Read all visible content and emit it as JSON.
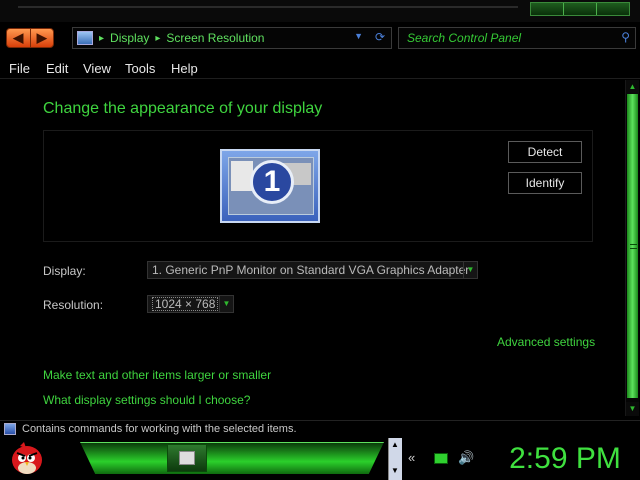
{
  "address_bar": {
    "crumbs": [
      "Display",
      "Screen Resolution"
    ],
    "separator": "▸"
  },
  "search": {
    "placeholder": "Search Control Panel"
  },
  "menu": {
    "items": [
      "File",
      "Edit",
      "View",
      "Tools",
      "Help"
    ]
  },
  "main": {
    "heading": "Change the appearance of your display",
    "monitor_number": "1",
    "detect_label": "Detect",
    "identify_label": "Identify",
    "display_label": "Display:",
    "display_value": "1. Generic PnP Monitor on Standard VGA Graphics Adapter",
    "resolution_label": "Resolution:",
    "resolution_value": "1024 × 768",
    "advanced_link": "Advanced settings",
    "text_size_link": "Make text and other items larger or smaller",
    "help_link": "What display settings should I choose?"
  },
  "status_bar": {
    "text": "Contains commands for working with the selected items."
  },
  "taskbar": {
    "clock": "2:59 PM"
  },
  "colors": {
    "accent_green": "#3fd43f",
    "nav_orange": "#e8621e",
    "link_blue": "#4a7fd8"
  }
}
